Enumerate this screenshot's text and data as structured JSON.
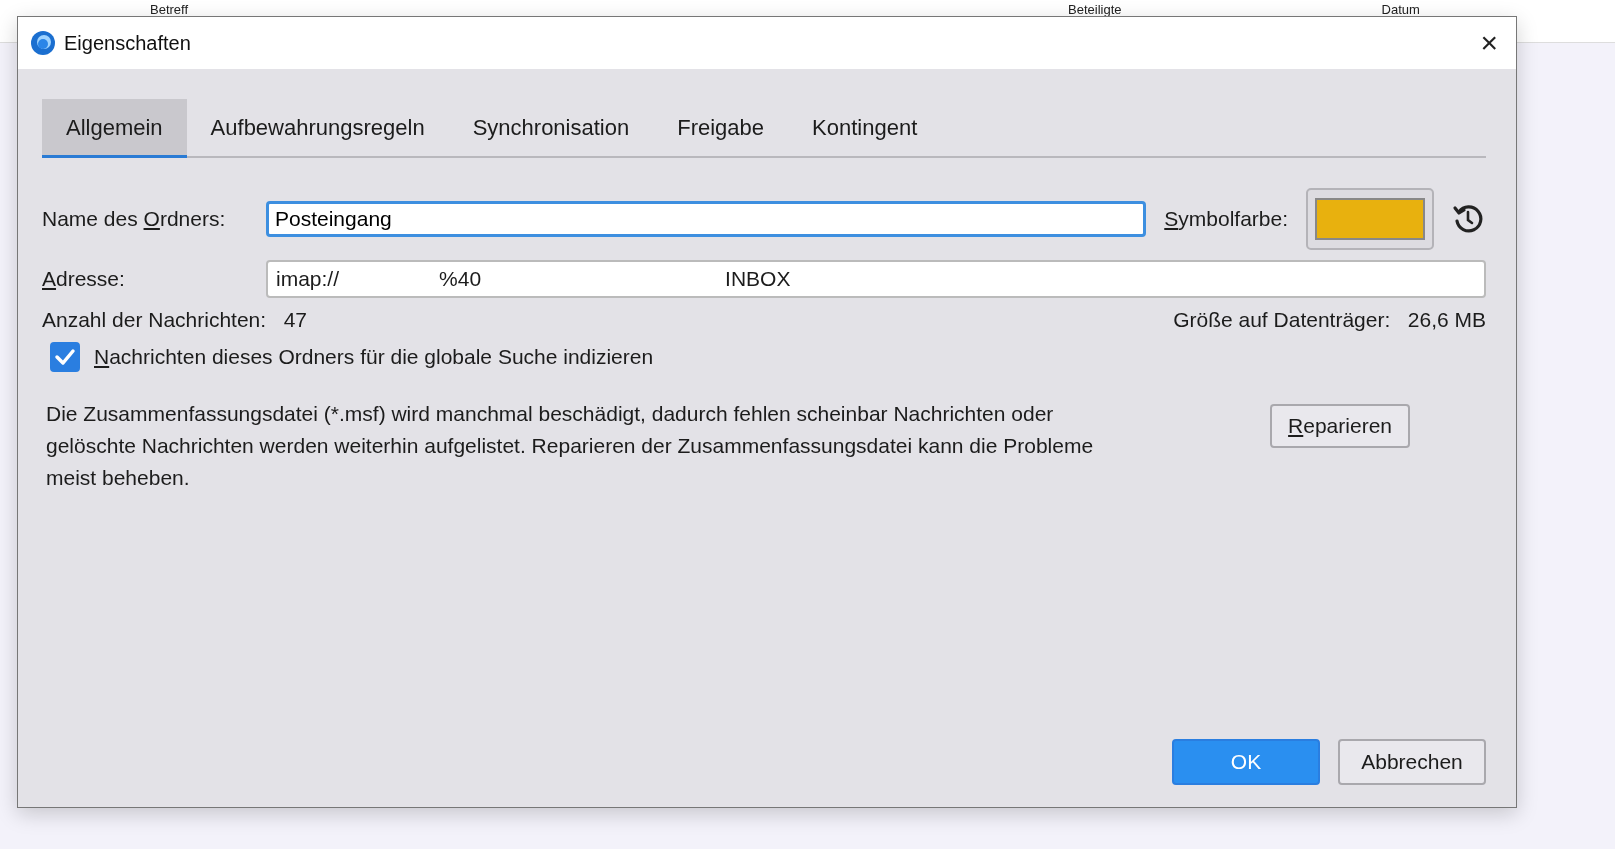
{
  "background": {
    "columns": [
      "Betreff",
      "Beteiligte",
      "Datum"
    ]
  },
  "window": {
    "title": "Eigenschaften",
    "close": "×"
  },
  "tabs": [
    {
      "label": "Allgemein",
      "selected": true
    },
    {
      "label": "Aufbewahrungsregeln",
      "selected": false
    },
    {
      "label": "Synchronisation",
      "selected": false
    },
    {
      "label": "Freigabe",
      "selected": false
    },
    {
      "label": "Kontingent",
      "selected": false
    }
  ],
  "name_field": {
    "label": {
      "before": "Name des ",
      "key": "O",
      "rest": "rdners:"
    },
    "value": "Posteingang"
  },
  "symbol_color": {
    "label": {
      "key": "S",
      "rest": "ymbolfarbe:"
    },
    "color": "#e8b10e"
  },
  "address": {
    "label": {
      "key": "A",
      "rest": "dresse:"
    },
    "parts": [
      "imap://",
      "%40",
      "INBOX"
    ]
  },
  "message_count": {
    "label": "Anzahl der Nachrichten:",
    "value": "47"
  },
  "disk_size": {
    "label": "Größe auf Datenträger:",
    "value": "26,6 MB"
  },
  "index_checkbox": {
    "label": {
      "key": "N",
      "rest": "achrichten dieses Ordners für die globale Suche indizieren"
    },
    "checked": true
  },
  "repair": {
    "text": "Die Zusammenfassungsdatei (*.msf) wird manchmal beschädigt, dadurch fehlen scheinbar Nachrichten oder gelöschte Nachrichten werden weiterhin aufgelistet. Reparieren der Zusammenfassungsdatei kann die Probleme meist beheben.",
    "button": {
      "key": "R",
      "rest": "eparieren"
    }
  },
  "buttons": [
    {
      "label": "OK",
      "kind": "primary"
    },
    {
      "label": "Abbrechen",
      "kind": "secondary"
    }
  ]
}
